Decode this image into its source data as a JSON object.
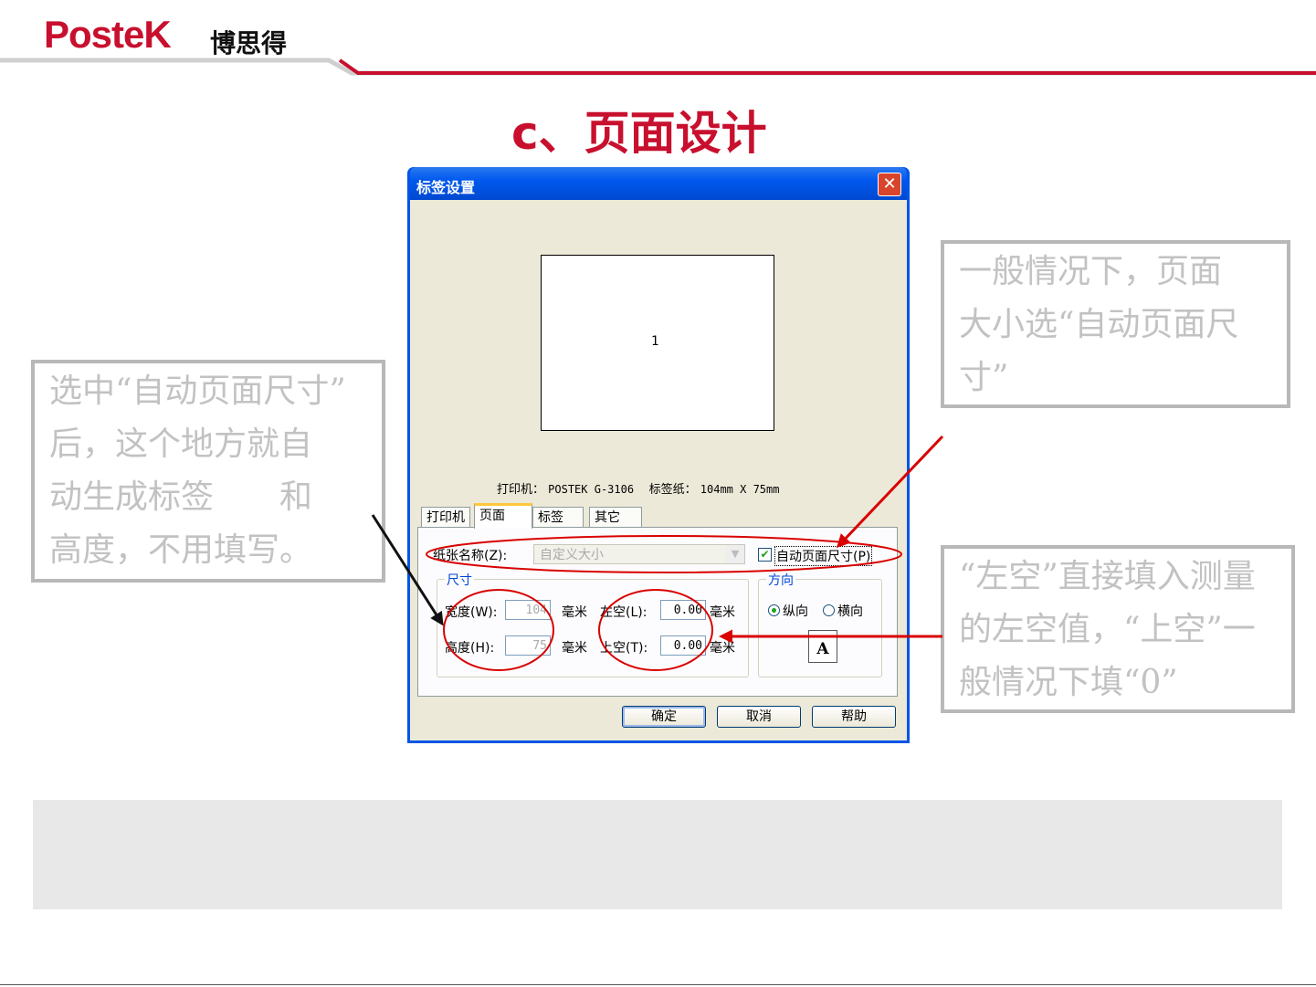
{
  "brand": {
    "logo_text": "PosteK",
    "logo_cn": "博思得",
    "accent_color": "#c8102e"
  },
  "slide_title": "c、页面设计",
  "dialog": {
    "title": "标签设置",
    "close_icon": "close-icon",
    "preview_number": "1",
    "status_printer_label": "打印机：",
    "status_printer_value": "POSTEK G-3106",
    "status_paper_label": "标签纸：",
    "status_paper_value": "104mm X 75mm",
    "tabs": [
      "打印机",
      "页面",
      "标签",
      "其它"
    ],
    "active_tab": "页面",
    "paper_name_label": "纸张名称(Z):",
    "paper_name_value": "自定义大小",
    "auto_size_label": "自动页面尺寸(P)",
    "auto_size_checked": true,
    "size_group_title": "尺寸",
    "width_label": "宽度(W):",
    "width_value": "104",
    "height_label": "高度(H):",
    "height_value": "75",
    "unit": "毫米",
    "left_margin_label": "左空(L):",
    "left_margin_value": "0.00",
    "top_margin_label": "上空(T):",
    "top_margin_value": "0.00",
    "orientation_group_title": "方向",
    "portrait_label": "纵向",
    "landscape_label": "横向",
    "orientation_selected": "纵向",
    "page_icon_letter": "A",
    "buttons": {
      "ok": "确定",
      "cancel": "取消",
      "help": "帮助"
    }
  },
  "callouts": {
    "left": [
      "选中“自动页面尺寸”",
      "后，这个地方就自",
      "动生成标签　　和",
      "高度，不用填写。"
    ],
    "top_right": [
      "一般情况下，页面",
      "大小选“自动页面尺",
      "寸”"
    ],
    "bottom_right": [
      "“左空”直接填入测量",
      "的左空值，“上空”一",
      "般情况下填“0”"
    ]
  },
  "annotation_color": "#d90000"
}
